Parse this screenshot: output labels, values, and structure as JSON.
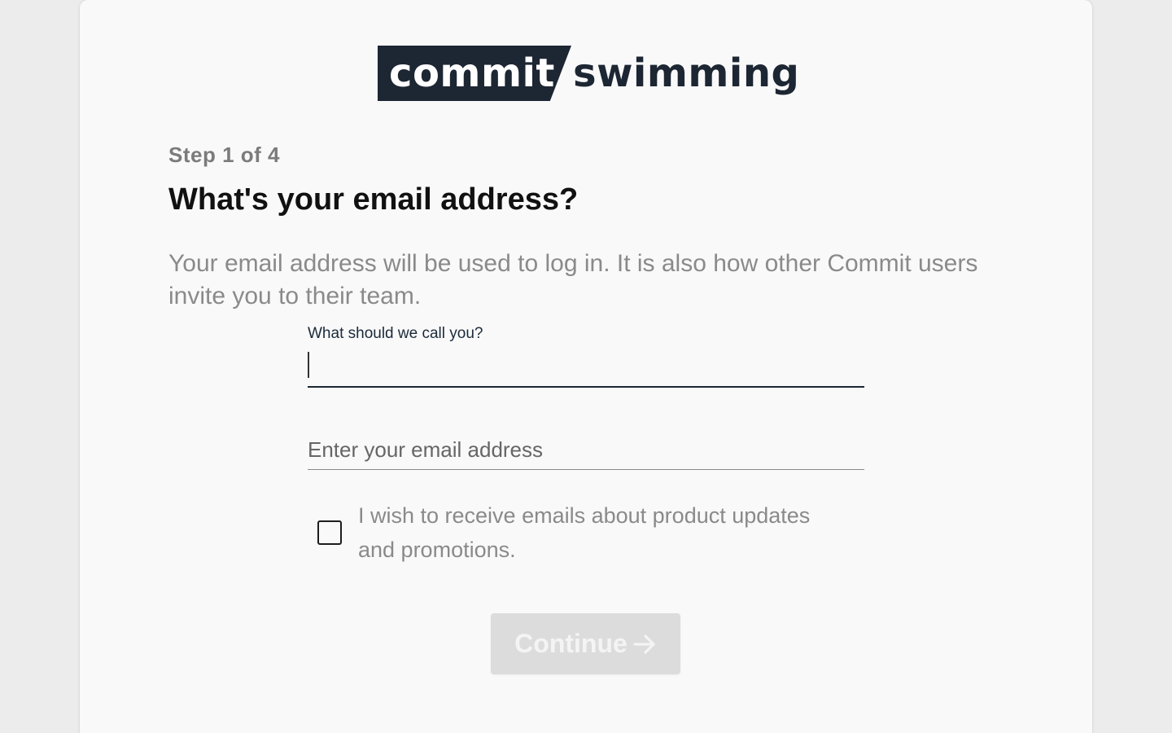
{
  "logo": {
    "boxed_word": "commit",
    "word": "swimming",
    "colors": {
      "dark": "#1d2633",
      "light": "#ffffff"
    }
  },
  "step": {
    "label": "Step 1 of 4"
  },
  "title": "What's your email address?",
  "description": "Your email address will be used to log in. It is also how other Commit users invite you to their team.",
  "name_field": {
    "label": "What should we call you?",
    "value": ""
  },
  "email_field": {
    "placeholder": "Enter your email address",
    "value": ""
  },
  "opt_in": {
    "checked": false,
    "label": "I wish to receive emails about product updates and promotions."
  },
  "continue_button": {
    "label": "Continue",
    "icon": "arrow-right-icon",
    "disabled": true
  }
}
